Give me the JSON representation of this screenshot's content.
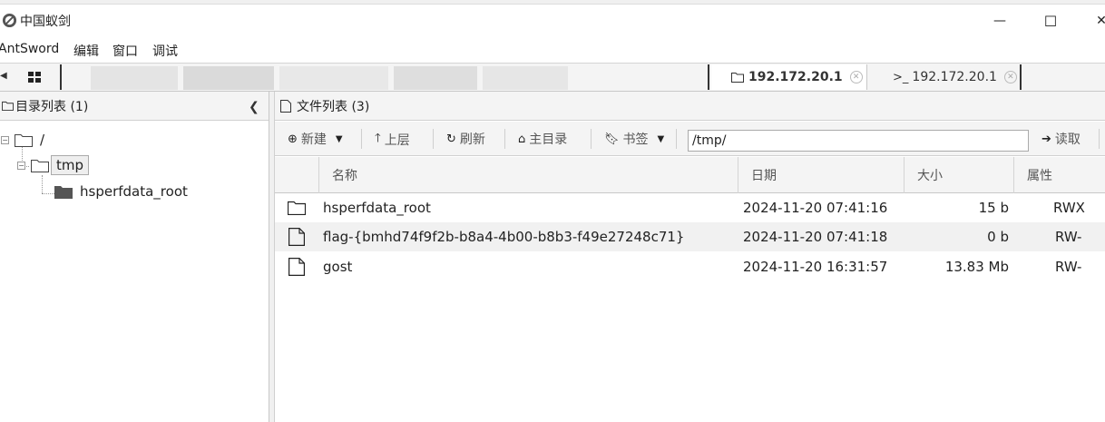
{
  "window": {
    "title": "中国蚁剑",
    "minimize_glyph": "—",
    "maximize_glyph": "☐",
    "close_glyph": "✕"
  },
  "menu": [
    "AntSword",
    "编辑",
    "窗口",
    "调试"
  ],
  "tabs": [
    {
      "label": "192.172.20.1",
      "icon": "folder-icon",
      "active": true
    },
    {
      "label": "192.172.20.1",
      "icon": "terminal-icon",
      "active": false
    }
  ],
  "left_panel": {
    "title": "目录列表 (1)",
    "tree": {
      "root": "/",
      "child": "tmp",
      "grandchild": "hsperfdata_root"
    }
  },
  "right_panel": {
    "title": "文件列表 (3)",
    "toolbar": {
      "new": "新建",
      "up": "上层",
      "refresh": "刷新",
      "home": "主目录",
      "bookmark": "书签",
      "path": "/tmp/",
      "read": "读取"
    },
    "columns": [
      "名称",
      "日期",
      "大小",
      "属性"
    ],
    "files": [
      {
        "type": "folder",
        "name": "hsperfdata_root",
        "date": "2024-11-20 07:41:16",
        "size": "15 b",
        "attr": "RWX"
      },
      {
        "type": "file",
        "name": "flag-{bmhd74f9f2b-b8a4-4b00-b8b3-f49e27248c71}",
        "date": "2024-11-20 07:41:18",
        "size": "0 b",
        "attr": "RW-"
      },
      {
        "type": "file",
        "name": "gost",
        "date": "2024-11-20 16:31:57",
        "size": "13.83 Mb",
        "attr": "RW-"
      }
    ]
  }
}
